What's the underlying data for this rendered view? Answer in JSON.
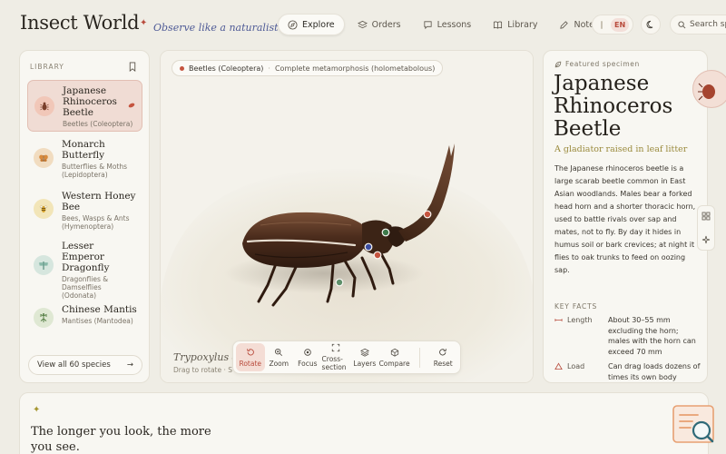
{
  "app": {
    "brand": "Insect World",
    "tagline": "Observe like a naturalist"
  },
  "nav": {
    "items": [
      {
        "label": "Explore",
        "icon": "compass-icon",
        "active": true
      },
      {
        "label": "Orders",
        "icon": "layers-icon",
        "active": false
      },
      {
        "label": "Lessons",
        "icon": "chat-icon",
        "active": false
      },
      {
        "label": "Library",
        "icon": "book-icon",
        "active": false
      },
      {
        "label": "Notes",
        "icon": "pencil-icon",
        "active": false
      }
    ],
    "language": "EN",
    "search_placeholder": "Search sp"
  },
  "library": {
    "heading": "LIBRARY",
    "items": [
      {
        "name": "Japanese Rhinoceros Beetle",
        "group": "Beetles (Coleoptera)",
        "badge_color": "#f1c7b8",
        "selected": true
      },
      {
        "name": "Monarch Butterfly",
        "group": "Butterflies & Moths (Lepidoptera)",
        "badge_color": "#f1dcc0",
        "selected": false
      },
      {
        "name": "Western Honey Bee",
        "group": "Bees, Wasps & Ants (Hymenoptera)",
        "badge_color": "#f2e5b8",
        "selected": false
      },
      {
        "name": "Lesser Emperor Dragonfly",
        "group": "Dragonflies & Damselflies (Odonata)",
        "badge_color": "#d6e6de",
        "selected": false
      },
      {
        "name": "Chinese Mantis",
        "group": "Mantises (Mantodea)",
        "badge_color": "#dfe8d3",
        "selected": false
      }
    ],
    "view_all_label": "View all 60 species"
  },
  "viewer": {
    "order": "Beetles (Coleoptera)",
    "development": "Complete metamorphosis (holometabolous)",
    "scientific_name": "Trypoxylus d",
    "hint": "Drag to rotate · S",
    "tools": [
      {
        "label": "Rotate",
        "icon": "rotate-icon",
        "active": true
      },
      {
        "label": "Zoom",
        "icon": "zoom-icon",
        "active": false
      },
      {
        "label": "Focus",
        "icon": "focus-icon",
        "active": false
      },
      {
        "label": "Cross-section",
        "icon": "cross-section-icon",
        "active": false
      },
      {
        "label": "Layers",
        "icon": "layers-icon",
        "active": false
      },
      {
        "label": "Compare",
        "icon": "compare-icon",
        "active": false
      },
      {
        "label": "Reset",
        "icon": "reset-icon",
        "active": false
      }
    ],
    "accent": "#b84b3c"
  },
  "featured": {
    "kicker": "Featured specimen",
    "title": "Japanese Rhinoceros Beetle",
    "subtitle": "A gladiator raised in leaf litter",
    "description": "The Japanese rhinoceros beetle is a large scarab beetle common in East Asian woodlands. Males bear a forked head horn and a shorter thoracic horn, used to battle rivals over sap and mates, not to fly. By day it hides in humus soil or bark crevices; at night it flies to oak trunks to feed on oozing sap.",
    "facts_heading": "KEY FACTS",
    "facts": [
      {
        "label": "Length",
        "value": "About 30–55 mm excluding the horn; males with the horn can exceed 70 mm"
      },
      {
        "label": "Load",
        "value": "Can drag loads dozens of times its own body weight"
      }
    ]
  },
  "bottom": {
    "headline": "The longer you look, the more you see."
  }
}
